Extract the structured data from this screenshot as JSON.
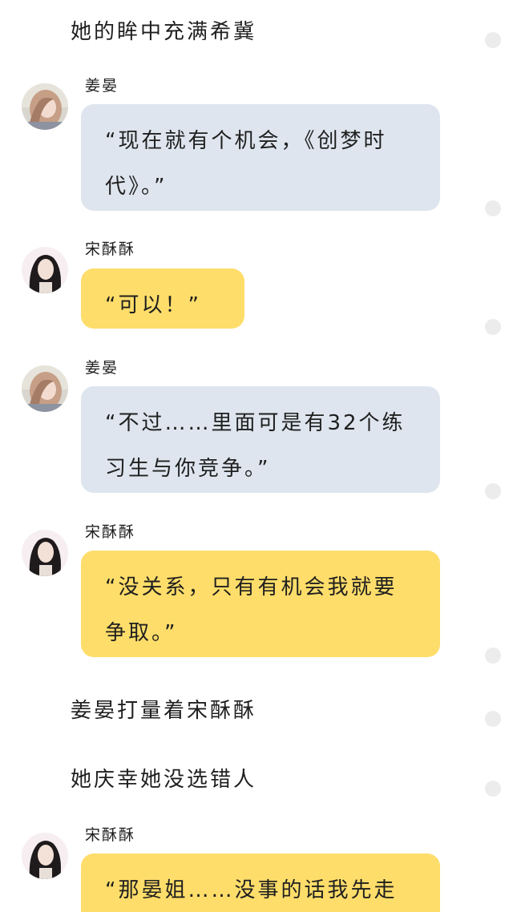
{
  "characters": {
    "jiang": {
      "name": "姜晏",
      "avatar_icon": "woman-light-hair-avatar"
    },
    "song": {
      "name": "宋酥酥",
      "avatar_icon": "woman-dark-hair-avatar"
    }
  },
  "messages": {
    "n1": "她的眸中充满希冀",
    "m1": {
      "speaker": "姜晏",
      "text": "“现在就有个机会，《创梦时代》。”"
    },
    "m2": {
      "speaker": "宋酥酥",
      "text": "“可以！”"
    },
    "m3": {
      "speaker": "姜晏",
      "text": "“不过……里面可是有32个练习生与你竞争。”"
    },
    "m4": {
      "speaker": "宋酥酥",
      "text": "“没关系，只有有机会我就要争取。”"
    },
    "n2": "姜晏打量着宋酥酥",
    "n3": "她庆幸她没选错人",
    "m5": {
      "speaker": "宋酥酥",
      "text": "“那晏姐……没事的话我先走"
    }
  },
  "colors": {
    "blue_bubble": "#dee5ee",
    "yellow_bubble": "#fedd6a",
    "side_dot": "#ececec"
  }
}
